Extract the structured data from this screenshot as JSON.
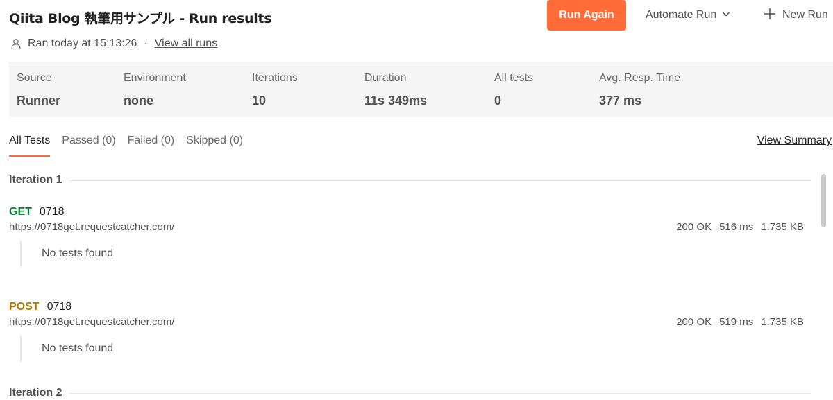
{
  "header": {
    "title": "Qiita Blog 執筆用サンプル - Run results",
    "run_again_label": "Run Again",
    "automate_label": "Automate Run",
    "new_run_label": "New Run"
  },
  "meta": {
    "ran_text": "Ran today at 15:13:26",
    "separator": "·",
    "view_all_label": "View all runs"
  },
  "stats": [
    {
      "label": "Source",
      "value": "Runner"
    },
    {
      "label": "Environment",
      "value": "none"
    },
    {
      "label": "Iterations",
      "value": "10"
    },
    {
      "label": "Duration",
      "value": "11s 349ms"
    },
    {
      "label": "All tests",
      "value": "0"
    },
    {
      "label": "Avg. Resp. Time",
      "value": "377 ms"
    }
  ],
  "tabs": [
    {
      "label": "All Tests",
      "active": true
    },
    {
      "label": "Passed (0)",
      "active": false
    },
    {
      "label": "Failed (0)",
      "active": false
    },
    {
      "label": "Skipped (0)",
      "active": false
    }
  ],
  "view_summary_label": "View Summary",
  "iterations": [
    {
      "label": "Iteration 1",
      "requests": [
        {
          "method": "GET",
          "name": "0718",
          "url": "https://0718get.requestcatcher.com/",
          "status": "200 OK",
          "time": "516 ms",
          "size": "1.735 KB",
          "tests_text": "No tests found"
        },
        {
          "method": "POST",
          "name": "0718",
          "url": "https://0718get.requestcatcher.com/",
          "status": "200 OK",
          "time": "519 ms",
          "size": "1.735 KB",
          "tests_text": "No tests found"
        }
      ]
    },
    {
      "label": "Iteration 2",
      "requests": []
    }
  ],
  "colors": {
    "accent": "#ff6c37",
    "get": "#007f31",
    "post": "#ad7a03"
  }
}
